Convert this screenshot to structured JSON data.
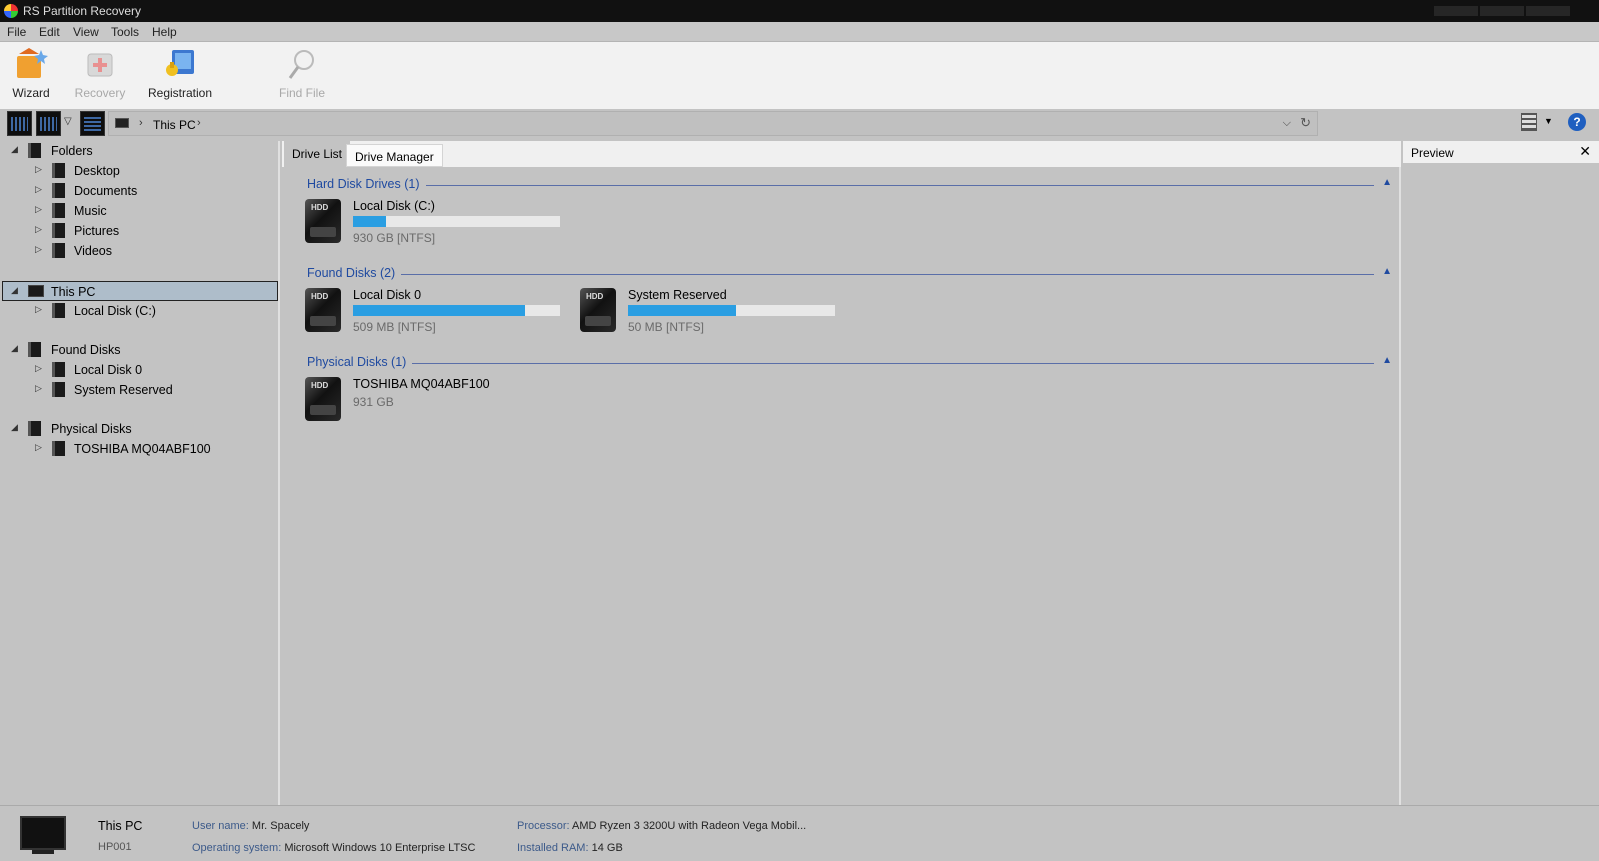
{
  "window": {
    "title": "RS Partition Recovery"
  },
  "menu": {
    "file": "File",
    "edit": "Edit",
    "view": "View",
    "tools": "Tools",
    "help": "Help"
  },
  "toolbar": {
    "wizard": "Wizard",
    "recovery": "Recovery",
    "registration": "Registration",
    "find_file": "Find File"
  },
  "address": {
    "crumb": "This PC"
  },
  "tree": {
    "folders": "Folders",
    "desktop": "Desktop",
    "documents": "Documents",
    "music": "Music",
    "pictures": "Pictures",
    "videos": "Videos",
    "this_pc": "This PC",
    "local_c": "Local Disk (C:)",
    "found_disks": "Found Disks",
    "local_disk_0": "Local Disk 0",
    "system_reserved": "System Reserved",
    "physical_disks": "Physical Disks",
    "toshiba": "TOSHIBA MQ04ABF100"
  },
  "tabs": {
    "drive_list": "Drive List",
    "drive_manager": "Drive Manager"
  },
  "sections": {
    "hdd": {
      "title": "Hard Disk Drives (1)",
      "drives": [
        {
          "name": "Local Disk (C:)",
          "info": "930 GB [NTFS]",
          "used": 0.16
        }
      ]
    },
    "found": {
      "title": "Found Disks (2)",
      "drives": [
        {
          "name": "Local Disk 0",
          "info": "509 MB [NTFS]",
          "used": 0.83
        },
        {
          "name": "System Reserved",
          "info": "50 MB [NTFS]",
          "used": 0.52
        }
      ]
    },
    "physical": {
      "title": "Physical Disks (1)",
      "drives": [
        {
          "name": "TOSHIBA MQ04ABF100",
          "info": "931 GB"
        }
      ]
    }
  },
  "hdd_label": "HDD",
  "preview": {
    "title": "Preview"
  },
  "status": {
    "name": "This PC",
    "host": "HP001",
    "user_label": "User name:",
    "user": "Mr. Spacely",
    "os_label": "Operating system:",
    "os": "Microsoft Windows 10 Enterprise LTSC",
    "cpu_label": "Processor:",
    "cpu": "AMD Ryzen 3 3200U with Radeon Vega Mobil...",
    "ram_label": "Installed RAM:",
    "ram": "14 GB"
  },
  "colors": {
    "accent": "#2a9ee2",
    "section_title": "#1f4aa0",
    "background": "#c3c3c3"
  },
  "icons": [
    "app-logo-icon",
    "wizard-icon",
    "recovery-icon",
    "registration-icon",
    "find-file-icon",
    "folder-icon",
    "hdd-icon",
    "monitor-icon",
    "close-icon",
    "help-icon"
  ]
}
